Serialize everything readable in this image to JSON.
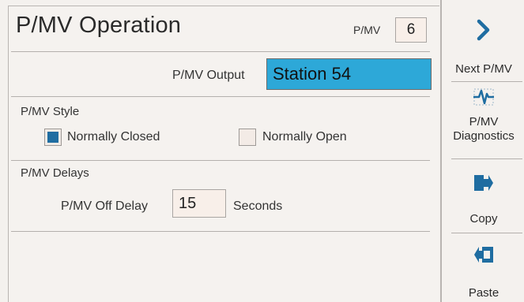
{
  "screen": {
    "title": "P/MV Operation",
    "pmv_label": "P/MV",
    "pmv_value": "6"
  },
  "output": {
    "label": "P/MV Output",
    "value": "Station 54",
    "highlight_color": "#2da8d8"
  },
  "style_section": {
    "heading": "P/MV Style",
    "options": [
      {
        "label": "Normally Closed",
        "checked": true
      },
      {
        "label": "Normally Open",
        "checked": false
      }
    ]
  },
  "delays_section": {
    "heading": "P/MV Delays",
    "off_delay_label": "P/MV Off Delay",
    "off_delay_value": "15",
    "unit": "Seconds"
  },
  "sidebar": {
    "buttons": [
      {
        "icon": "chevron-right-icon",
        "label": "Next P/MV"
      },
      {
        "icon": "diagnostics-icon",
        "label_line1": "P/MV",
        "label_line2": "Diagnostics"
      },
      {
        "icon": "copy-icon",
        "label": "Copy"
      },
      {
        "icon": "paste-icon",
        "label": "Paste"
      }
    ],
    "accent_color": "#1f6da1"
  }
}
